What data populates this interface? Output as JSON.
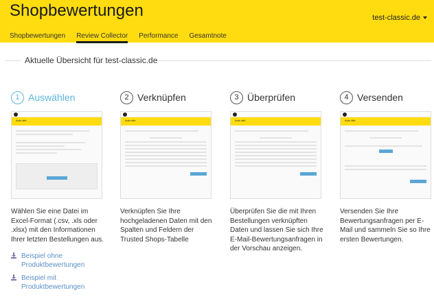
{
  "header": {
    "title": "Shopbewertungen",
    "account": "test-classic.de",
    "tabs": [
      {
        "label": "Shopbewertungen"
      },
      {
        "label": "Review Collector"
      },
      {
        "label": "Performance"
      },
      {
        "label": "Gesamtnote"
      }
    ]
  },
  "overview_title": "Aktuelle Übersicht für test-classic.de",
  "steps": [
    {
      "num": "1",
      "label": "Auswählen",
      "desc": "Wählen Sie eine Datei im Excel-Format (.csv, .xls oder .xlsx) mit den Informationen Ihrer letzten Bestellungen aus."
    },
    {
      "num": "2",
      "label": "Verknüpfen",
      "desc": "Verknüpfen Sie Ihre hochgeladenen Daten mit den Spalten und Feldern der Trusted Shops-Tabelle"
    },
    {
      "num": "3",
      "label": "Überprüfen",
      "desc": "Überprüfen Sie die mit Ihren Bestellungen verknüpften Daten und lassen Sie sich Ihre E-Mail-Bewertungsanfragen in der Vorschau anzeigen."
    },
    {
      "num": "4",
      "label": "Versenden",
      "desc": "Versenden Sie Ihre Bewertungsanfragen per E-Mail und sammeln Sie so Ihre ersten Bewertungen."
    }
  ],
  "downloads": [
    {
      "label": "Beispiel ohne Produktbewertungen",
      "icon": "download-icon"
    },
    {
      "label": "Beispiel mit Produktbewertungen",
      "icon": "download-icon"
    }
  ],
  "thumb_site_label": "Auto site",
  "colors": {
    "brand": "#ffdc0f",
    "accent": "#5bb5e0",
    "link": "#5b8fc7"
  }
}
